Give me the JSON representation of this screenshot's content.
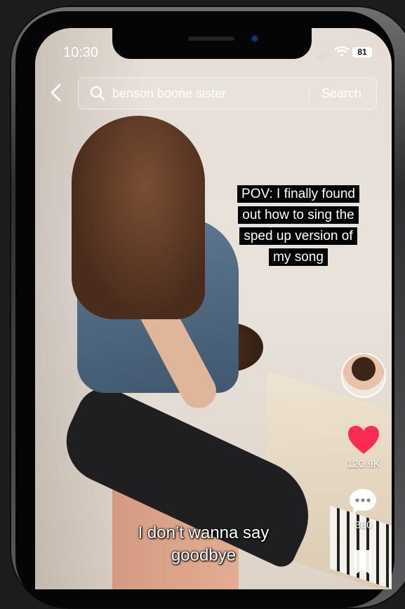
{
  "status_bar": {
    "time": "10:30",
    "battery": "81"
  },
  "search": {
    "query": "benson boone sister",
    "button_label": "Search"
  },
  "video": {
    "caption_lines": [
      "POV: I finally found",
      "out how to sing the",
      "sped up version of",
      "my song"
    ],
    "subtitle_lines": [
      "I don’t wanna say",
      "goodbye"
    ]
  },
  "actions": {
    "likes": "120.9K",
    "comments": "380"
  },
  "colors": {
    "like": "#fe2c55",
    "caption_bg": "#000000"
  },
  "icons": [
    "back-icon",
    "search-icon",
    "heart-icon",
    "comment-icon",
    "bookmark-icon",
    "wifi-icon",
    "signal-icon",
    "battery-icon"
  ]
}
